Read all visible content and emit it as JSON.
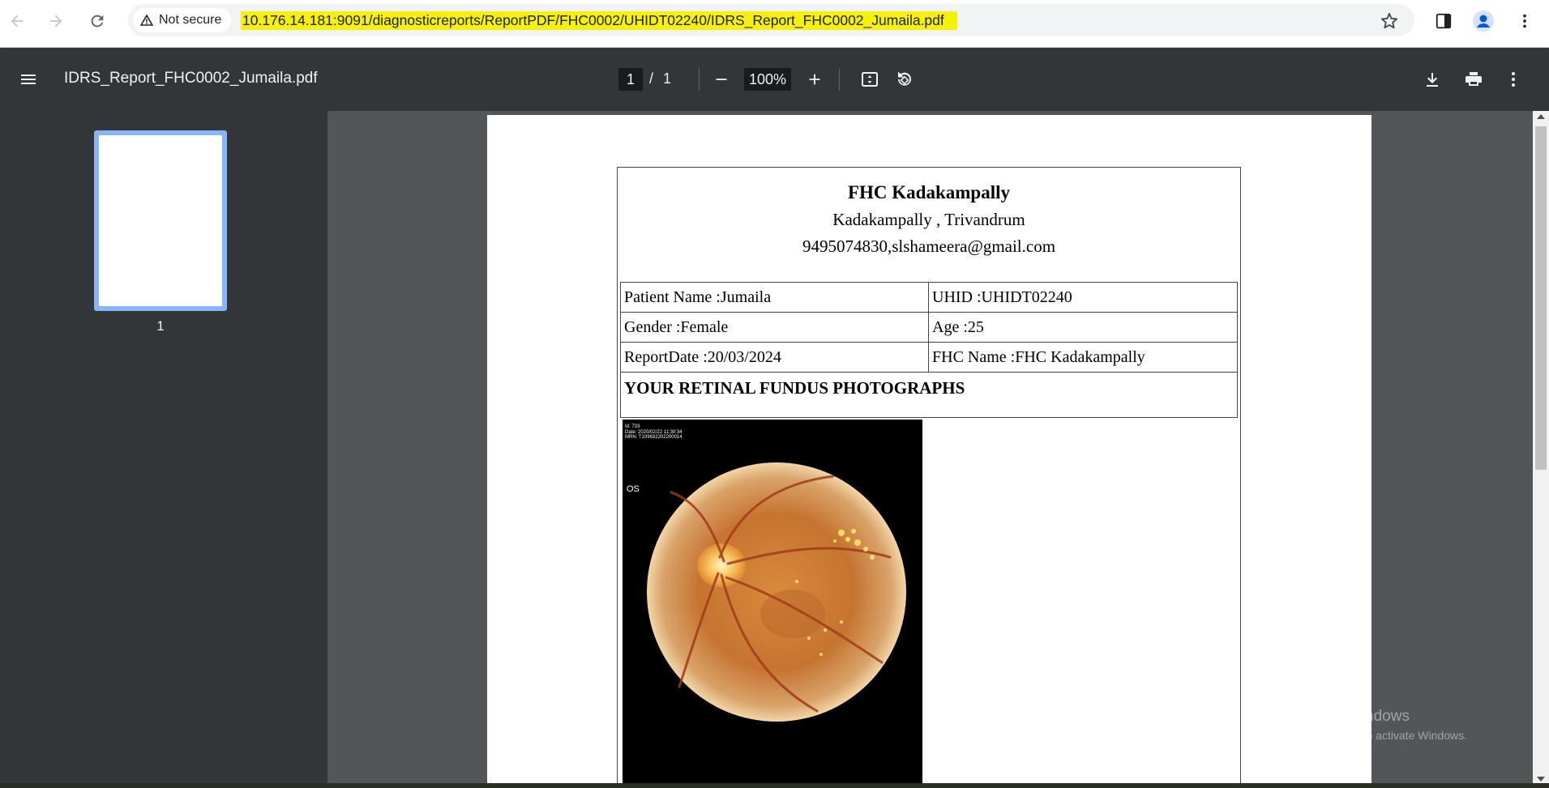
{
  "browser": {
    "security_label": "Not secure",
    "url": "10.176.14.181:9091/diagnosticreports/ReportPDF/FHC0002/UHIDT02240/IDRS_Report_FHC0002_Jumaila.pdf",
    "url_highlight_color": "#f5f10a"
  },
  "pdf_toolbar": {
    "title": "IDRS_Report_FHC0002_Jumaila.pdf",
    "page_current": "1",
    "page_separator": "/",
    "page_total": "1",
    "zoom": "100%"
  },
  "sidebar": {
    "thumbnails": [
      {
        "label": "1",
        "selected": true
      }
    ],
    "selection_color": "#8ab4f8"
  },
  "report": {
    "facility_name": "FHC Kadakampally",
    "address": "Kadakampally , Trivandrum",
    "contact": "9495074830,slshameera@gmail.com",
    "patient_name": "Patient Name :Jumaila",
    "uhid": "UHID :UHIDT02240",
    "gender": "Gender :Female",
    "age": "Age :25",
    "report_date": "ReportDate :20/03/2024",
    "fhc_name": "FHC Name :FHC Kadakampally",
    "section_title": "YOUR RETINAL FUNDUS PHOTOGRAPHS",
    "fundus_image": {
      "meta_line1": "Id: 733",
      "meta_line2": "Date: 2020/02/22 11:30:34",
      "meta_line3": "MRN: T109632202200014",
      "eye_label": "OS"
    }
  },
  "watermark": {
    "line1": "Activate Windows",
    "line2": "Go to Settings to activate Windows."
  }
}
